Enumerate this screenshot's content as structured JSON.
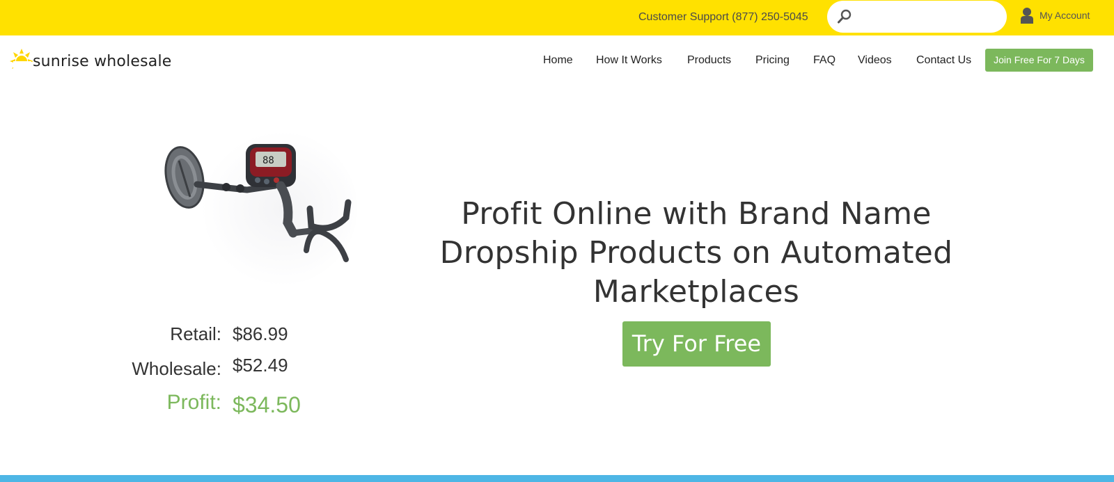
{
  "topbar": {
    "support_text": "Customer Support (877) 250-5045",
    "search_placeholder": "",
    "account_label": "My Account",
    "bg_color": "#ffe100"
  },
  "brand": {
    "name": "sunrise wholesale",
    "logo_icon": "sun-icon"
  },
  "nav": {
    "items": [
      "Home",
      "How It Works",
      "Products",
      "Pricing",
      "FAQ",
      "Videos",
      "Contact Us"
    ],
    "join_label": "Join Free For 7 Days",
    "accent_color": "#7cb85c"
  },
  "hero": {
    "product_image": "metal-detector-image",
    "retail_label": "Retail:",
    "retail_value": "$86.99",
    "wholesale_label": "Wholesale:",
    "wholesale_value": "$52.49",
    "profit_label": "Profit:",
    "profit_value": "$34.50",
    "headline": "Profit Online with Brand Name Dropship Products on Automated Marketplaces",
    "cta_label": "Try For Free"
  },
  "footer": {
    "bar_color": "#4eb6e5"
  }
}
